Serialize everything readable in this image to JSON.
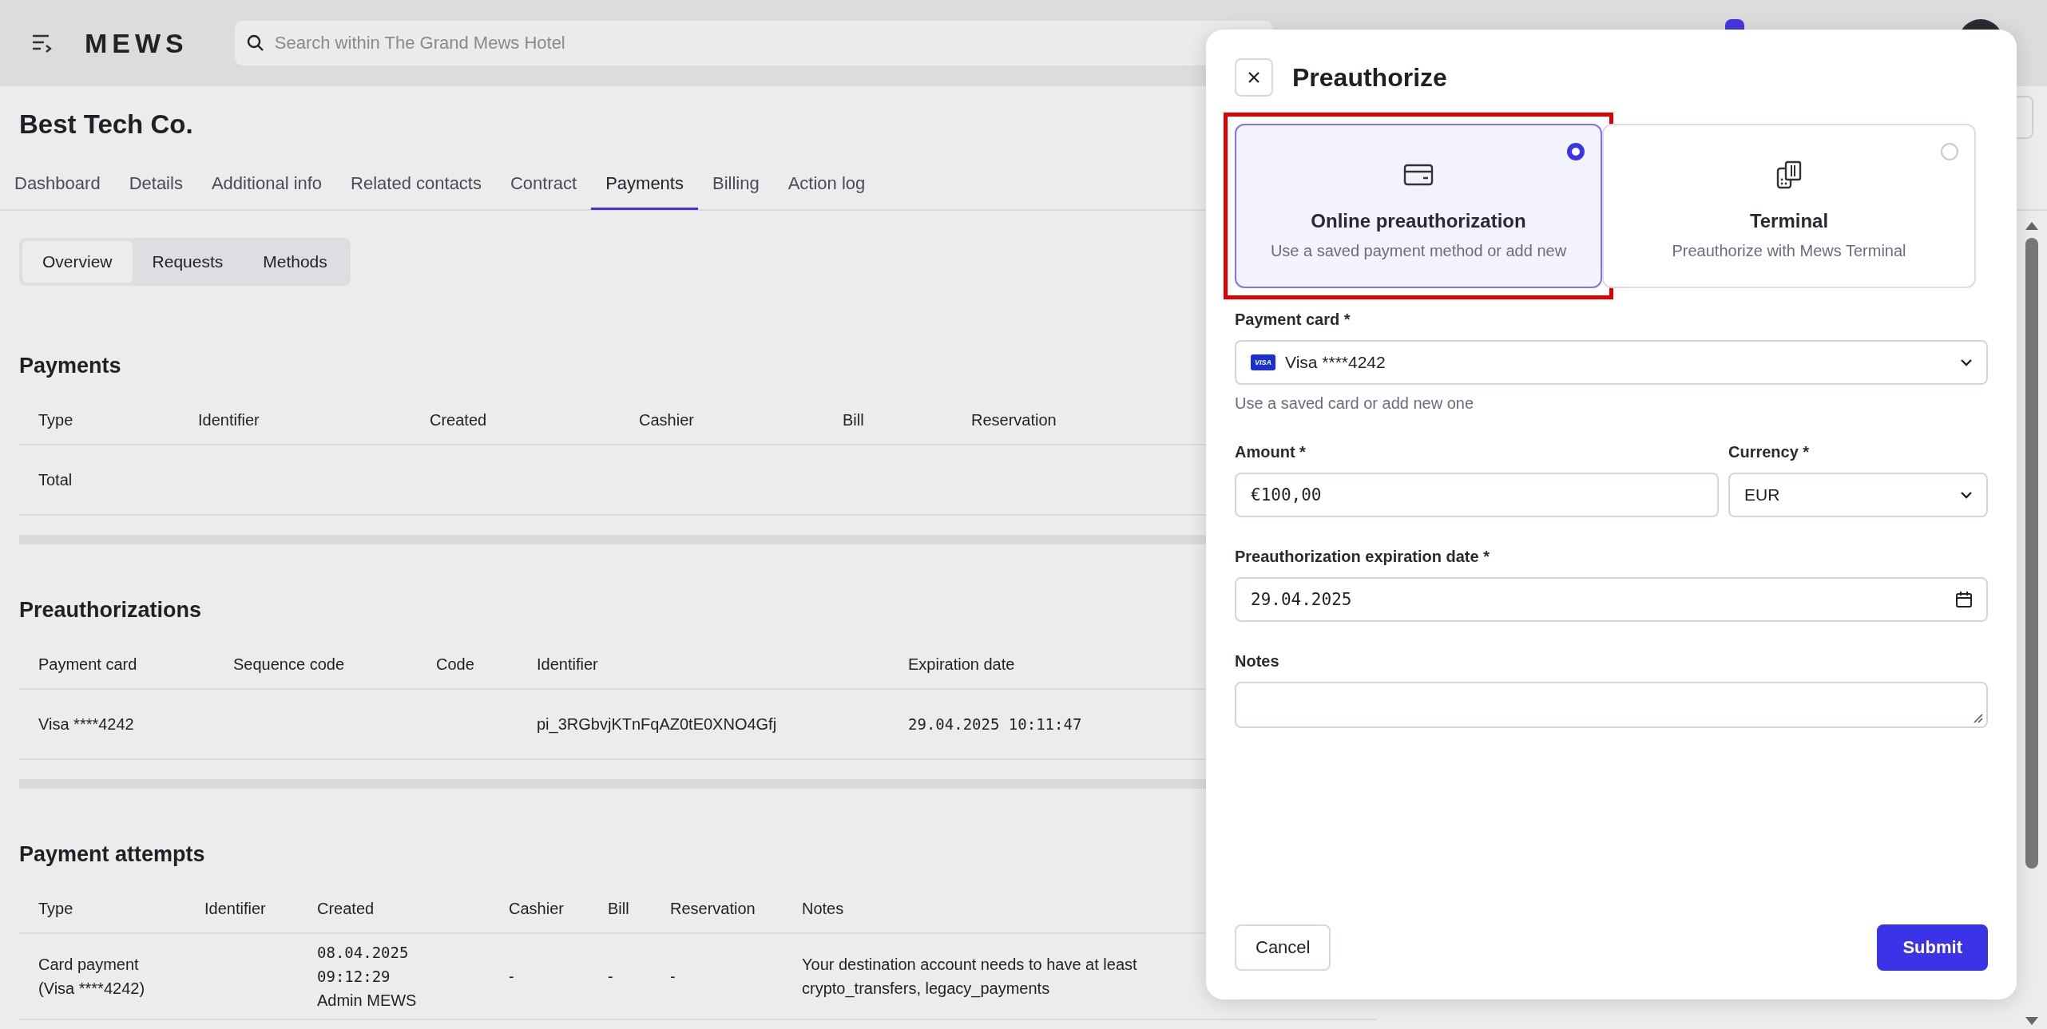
{
  "app_bar": {
    "logo": "MEWS",
    "search": {
      "placeholder": "Search within The Grand Mews Hotel"
    }
  },
  "page": {
    "title": "Best Tech Co.",
    "tabs": [
      {
        "label": "Dashboard",
        "selected": false
      },
      {
        "label": "Details",
        "selected": false
      },
      {
        "label": "Additional info",
        "selected": false
      },
      {
        "label": "Related contacts",
        "selected": false
      },
      {
        "label": "Contract",
        "selected": false
      },
      {
        "label": "Payments",
        "selected": true
      },
      {
        "label": "Billing",
        "selected": false
      },
      {
        "label": "Action log",
        "selected": false
      }
    ],
    "subtabs": [
      {
        "label": "Overview",
        "selected": true
      },
      {
        "label": "Requests",
        "selected": false
      },
      {
        "label": "Methods",
        "selected": false
      }
    ]
  },
  "sections": [
    {
      "title": "Payments",
      "columns": [
        "Type",
        "Identifier",
        "Created",
        "Cashier",
        "Bill",
        "Reservation"
      ],
      "rows": [
        [
          [
            {
              "text": "Total",
              "kind": "text"
            }
          ],
          null,
          null,
          null,
          null,
          null
        ]
      ]
    },
    {
      "title": "Preauthorizations",
      "columns": [
        "Payment card",
        "Sequence code",
        "Code",
        "Identifier",
        "Expiration date"
      ],
      "rows": [
        [
          [
            {
              "text": "Visa ****4242",
              "kind": "text"
            }
          ],
          null,
          null,
          [
            {
              "text": "pi_3RGbvjKTnFqAZ0tE0XNO4Gfj",
              "kind": "text"
            }
          ],
          [
            {
              "text": "29.04.2025 10:11:47",
              "kind": "mono"
            }
          ]
        ]
      ]
    },
    {
      "title": "Payment attempts",
      "columns": [
        "Type",
        "Identifier",
        "Created",
        "Cashier",
        "Bill",
        "Reservation",
        "Notes"
      ],
      "rows": [
        [
          [
            {
              "text": "Card payment",
              "kind": "text"
            },
            {
              "text": "(Visa ****4242)",
              "kind": "text"
            }
          ],
          null,
          [
            {
              "text": "08.04.2025",
              "kind": "mono"
            },
            {
              "text": "09:12:29",
              "kind": "mono"
            },
            {
              "text": "Admin MEWS",
              "kind": "text"
            }
          ],
          [
            {
              "text": "-",
              "kind": "text"
            }
          ],
          [
            {
              "text": "-",
              "kind": "text"
            }
          ],
          [
            {
              "text": "-",
              "kind": "text"
            }
          ],
          [
            {
              "text": "Your destination account needs to have at least",
              "kind": "text"
            },
            {
              "text": "crypto_transfers, legacy_payments",
              "kind": "text"
            }
          ]
        ]
      ]
    }
  ],
  "dialog": {
    "title": "Preauthorize",
    "options": [
      {
        "kind": "card",
        "title": "Online preauthorization",
        "description": "Use a saved payment method or add new",
        "selected": true,
        "highlighted": true
      },
      {
        "kind": "terminal",
        "title": "Terminal",
        "description": "Preauthorize with Mews Terminal",
        "selected": false,
        "highlighted": false
      }
    ],
    "field_rows": [
      [
        {
          "kind": "select",
          "label": "Payment card *",
          "brand": "VISA",
          "value": "Visa ****4242",
          "hint": "Use a saved card or add new one"
        }
      ],
      [
        {
          "kind": "input",
          "label": "Amount *",
          "value": "€100,00"
        },
        {
          "kind": "select",
          "label": "Currency *",
          "value": "EUR"
        }
      ],
      [
        {
          "kind": "date",
          "label": "Preauthorization expiration date *",
          "value": "29.04.2025"
        }
      ],
      [
        {
          "kind": "textarea",
          "label": "Notes"
        }
      ]
    ],
    "buttons": [
      {
        "kind": "secondary",
        "label": "Cancel"
      },
      {
        "kind": "primary",
        "label": "Submit"
      }
    ]
  }
}
